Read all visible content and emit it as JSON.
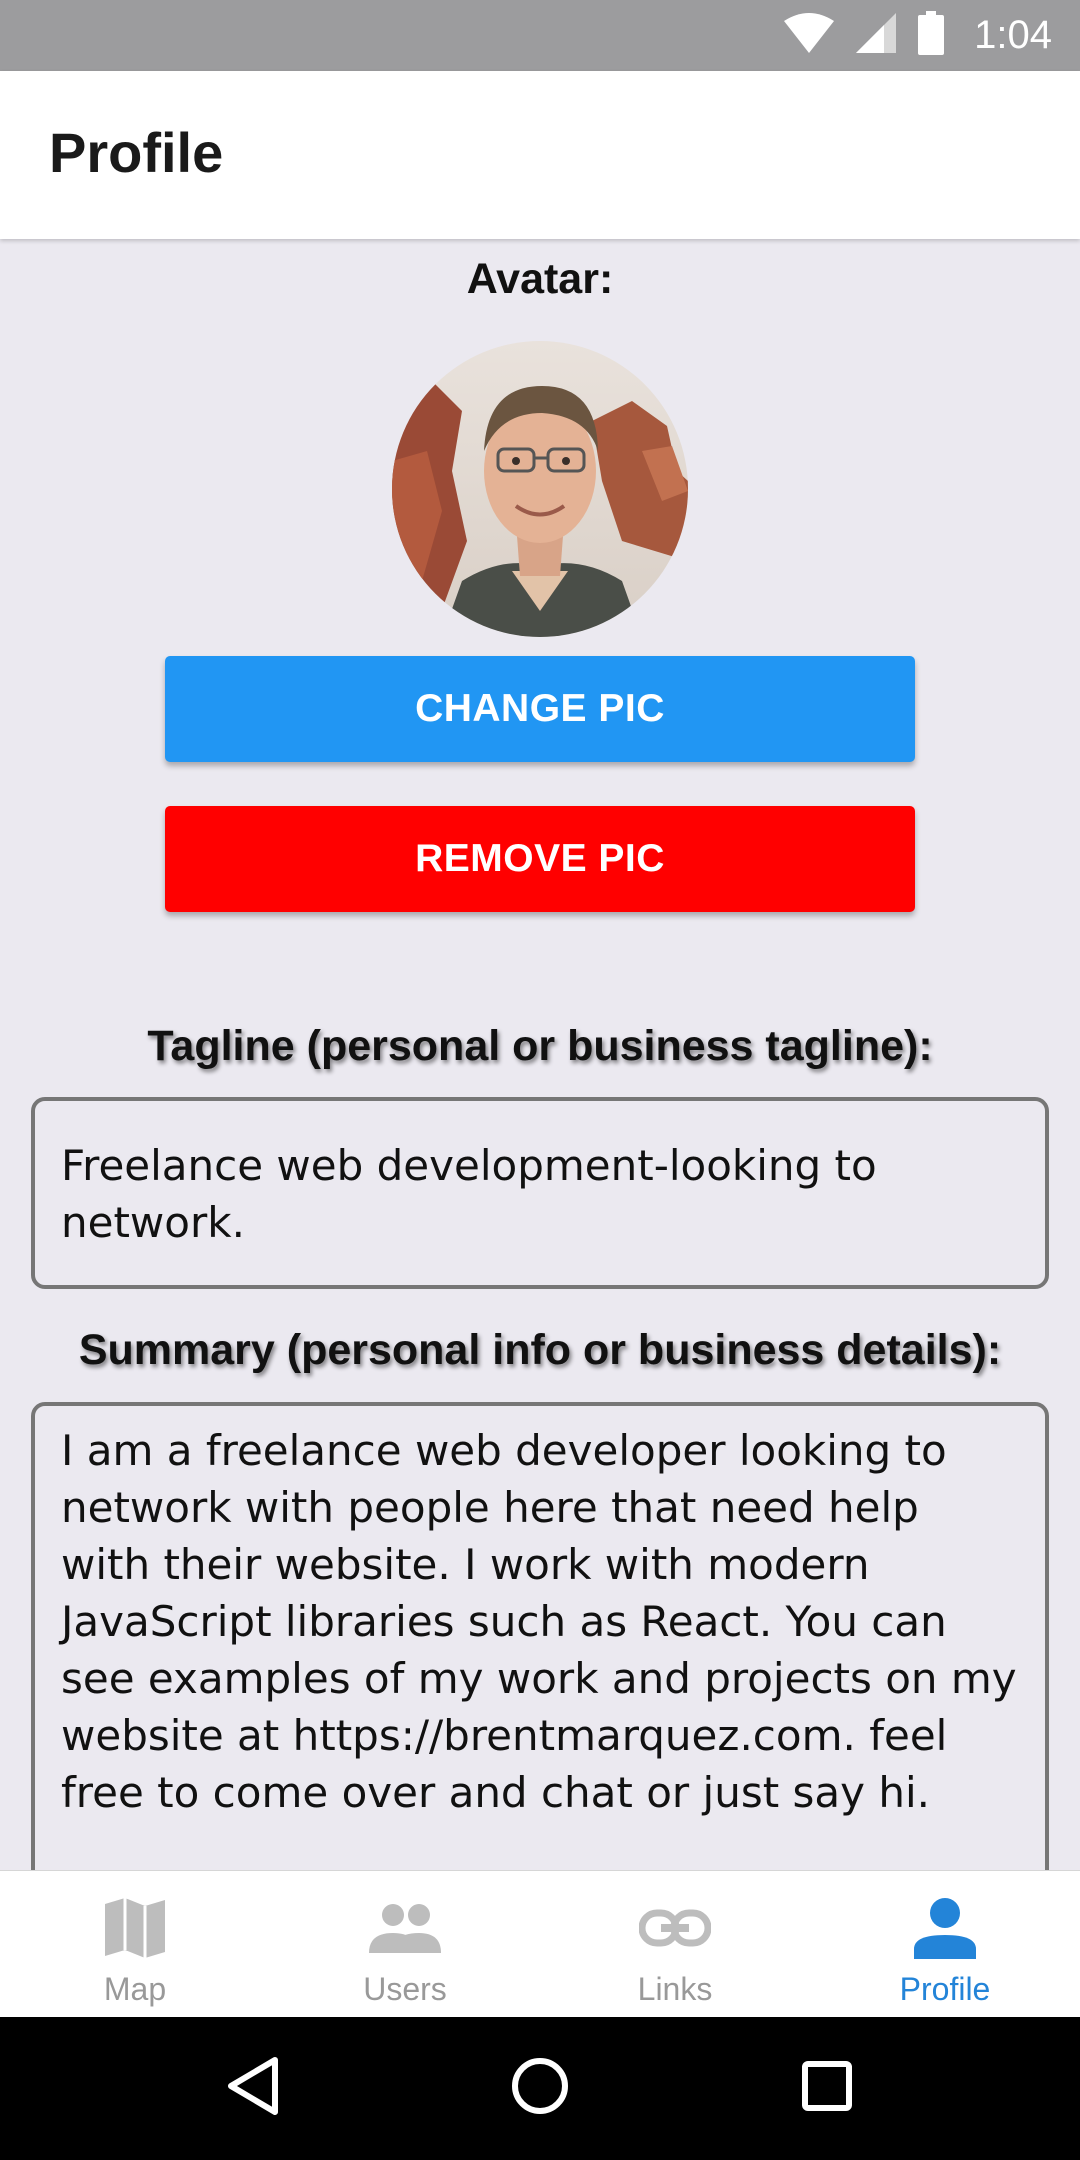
{
  "status_bar": {
    "time": "1:04",
    "icons": [
      "wifi-icon",
      "cell-signal-icon",
      "battery-icon"
    ]
  },
  "header": {
    "title": "Profile"
  },
  "profile": {
    "avatar_label": "Avatar:",
    "avatar_alt": "profile photo",
    "change_pic_label": "CHANGE PIC",
    "remove_pic_label": "REMOVE PIC",
    "tagline_label": "Tagline (personal or business tagline):",
    "tagline_value": "Freelance web development-looking to network.",
    "summary_label": "Summary (personal info or business details):",
    "summary_value": "I am a freelance web developer looking to network with people here that need help with their website.  I work with modern JavaScript libraries such as React.  You can see examples of my work and projects on my website at https://brentmarquez.com.  feel free to come over and chat or just say hi."
  },
  "tabs": [
    {
      "label": "Map",
      "icon": "map-icon",
      "active": false
    },
    {
      "label": "Users",
      "icon": "users-icon",
      "active": false
    },
    {
      "label": "Links",
      "icon": "link-icon",
      "active": false
    },
    {
      "label": "Profile",
      "icon": "person-icon",
      "active": true
    }
  ],
  "nav_bar": {
    "buttons": [
      "back-icon",
      "home-icon",
      "recents-icon"
    ]
  },
  "colors": {
    "status_bar": "#9c9c9e",
    "background": "#ebe9f0",
    "change_button": "#2196f3",
    "remove_button": "#ff0000",
    "active_tab": "#2384d8",
    "inactive_tab": "#999999"
  }
}
